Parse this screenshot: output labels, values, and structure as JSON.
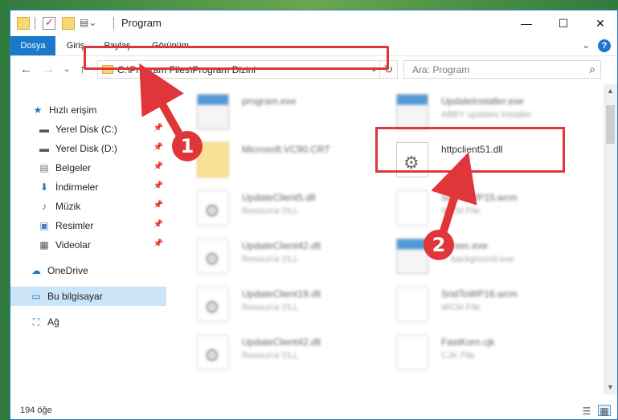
{
  "window": {
    "title": "Program",
    "minimize": "—",
    "maximize": "☐",
    "close": "✕"
  },
  "ribbon": {
    "tabs": [
      "Dosya",
      "Giriş",
      "Paylaş",
      "Görünüm"
    ],
    "expand": "⌄",
    "help": "?"
  },
  "nav": {
    "back": "←",
    "forward": "→",
    "recent": "⌄",
    "up": "↑",
    "address": "C:\\Program Files\\Program Dizini",
    "address_dropdown": "⌄",
    "refresh": "↻",
    "search_placeholder": "Ara: Program",
    "search_icon": "⌕"
  },
  "sidebar": {
    "items": [
      {
        "label": "Hızlı erişim",
        "icon": "star-icon",
        "glyph": "★",
        "pinned": false,
        "selected": false
      },
      {
        "label": "Yerel Disk (C:)",
        "icon": "drive-icon",
        "glyph": "▬",
        "pinned": true,
        "selected": false
      },
      {
        "label": "Yerel Disk (D:)",
        "icon": "drive-icon",
        "glyph": "▬",
        "pinned": true,
        "selected": false
      },
      {
        "label": "Belgeler",
        "icon": "documents-icon",
        "glyph": "▤",
        "pinned": true,
        "selected": false
      },
      {
        "label": "İndirmeler",
        "icon": "downloads-icon",
        "glyph": "⬇",
        "pinned": true,
        "selected": false
      },
      {
        "label": "Müzik",
        "icon": "music-icon",
        "glyph": "♪",
        "pinned": true,
        "selected": false
      },
      {
        "label": "Resimler",
        "icon": "pictures-icon",
        "glyph": "▣",
        "pinned": true,
        "selected": false
      },
      {
        "label": "Videolar",
        "icon": "videos-icon",
        "glyph": "▦",
        "pinned": true,
        "selected": false
      },
      {
        "label": "OneDrive",
        "icon": "cloud-icon",
        "glyph": "☁",
        "pinned": false,
        "selected": false
      },
      {
        "label": "Bu bilgisayar",
        "icon": "computer-icon",
        "glyph": "▭",
        "pinned": false,
        "selected": true
      },
      {
        "label": "Ağ",
        "icon": "network-icon",
        "glyph": "⛶",
        "pinned": false,
        "selected": false
      }
    ],
    "pin_glyph": "📌"
  },
  "files": [
    {
      "name": "program.exe",
      "sub": "",
      "icon": "exe",
      "blurred": true
    },
    {
      "name": "UpdateInstaller.exe",
      "sub": "ABBY updates installer",
      "icon": "app",
      "blurred": true
    },
    {
      "name": "Microsoft.VC90.CRT",
      "sub": "",
      "icon": "folder",
      "blurred": true
    },
    {
      "name": "httpclient51.dll",
      "sub": "",
      "icon": "dll",
      "blurred": false
    },
    {
      "name": "UpdateClient5.dll",
      "sub": "Resource DLL",
      "icon": "dll",
      "blurred": true
    },
    {
      "name": "SndToWP15.wcm",
      "sub": "WCM File",
      "icon": "doc",
      "blurred": true
    },
    {
      "name": "UpdateClient42.dll",
      "sub": "Resource DLL",
      "icon": "dll",
      "blurred": true
    },
    {
      "name": "...exec.exe",
      "sub": "... background.exe",
      "icon": "app",
      "blurred": true
    },
    {
      "name": "UpdateClient19.dll",
      "sub": "Resource DLL",
      "icon": "dll",
      "blurred": true
    },
    {
      "name": "SndToWP16.wcm",
      "sub": "WCM File",
      "icon": "doc",
      "blurred": true
    },
    {
      "name": "UpdateClient42.dll",
      "sub": "Resource DLL",
      "icon": "dll",
      "blurred": true
    },
    {
      "name": "FastKorn.cjk",
      "sub": "CJK File",
      "icon": "doc",
      "blurred": true
    }
  ],
  "status": {
    "count": "194 öğe"
  },
  "annotations": {
    "badge1": "1",
    "badge2": "2",
    "color": "#e0363a"
  }
}
